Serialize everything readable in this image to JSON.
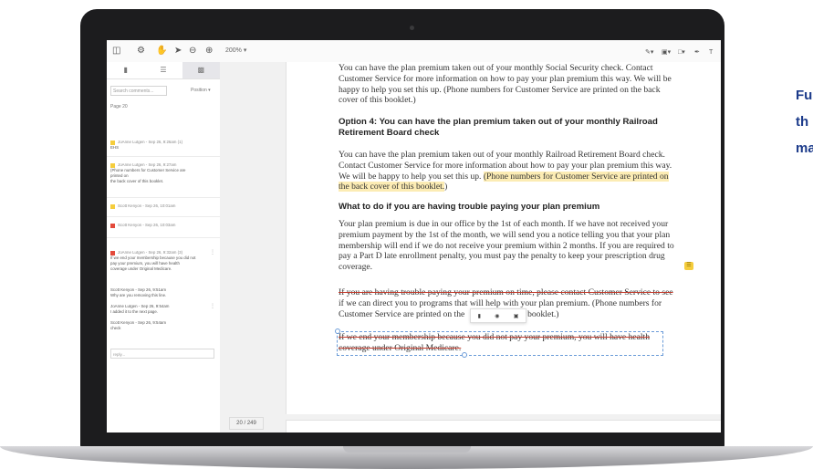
{
  "side_text": [
    "Fu",
    "th",
    "ma"
  ],
  "toolbar": {
    "zoom": "200%",
    "left_icons": [
      "panel-icon",
      "gear-icon",
      "hand-icon",
      "pointer-icon",
      "zoom-out-icon",
      "zoom-in-icon"
    ],
    "right_icons": [
      "pen-tool-icon",
      "shape-tool-icon",
      "comment-tool-icon",
      "signature-icon",
      "text-tool-icon"
    ]
  },
  "sidebar": {
    "search_placeholder": "Search comments...",
    "position_label": "Position",
    "page_label": "Page 20",
    "comments": [
      {
        "header": "JoAnne Lutgen - Sep 26, 9:26am (1)",
        "body": [
          "EHS"
        ],
        "color": "#f5cd3d"
      },
      {
        "header": "JoAnne Lutgen - Sep 26, 9:27am",
        "body": [
          "(Phone numbers for Customer Service are",
          "printed on",
          "the back cover of this booklet."
        ],
        "color": "#f5cd3d"
      },
      {
        "header": "Scott Kenyon - Sep 26, 10:01am",
        "body": [],
        "color": "#f5cd3d"
      },
      {
        "header": "Scott Kenyon - Sep 26, 10:03am",
        "body": [],
        "color": "#e34a3b"
      },
      {
        "header": "JoAnne Lutgen - Sep 26, 9:32am (3)",
        "body": [
          "If we end your membership because you did not",
          "pay your premium, you will have health",
          "coverage under Original Medicare."
        ],
        "color": "#e34a3b"
      }
    ],
    "replies": [
      {
        "header": "Scott Kenyon - Sep 26, 9:51am",
        "body": "Why are you removing this line."
      },
      {
        "header": "JoAnne Lutgen - Sep 26, 9:54am",
        "body": "I added it to the next page."
      },
      {
        "header": "Scott Kenyon - Sep 26, 9:54am",
        "body": "check"
      }
    ],
    "reply_placeholder": "reply..."
  },
  "page_count": "20 / 249",
  "doc": {
    "p1": [
      "You can have the plan premium taken out of your monthly Social Security check. Contact",
      "Customer Service for more information on how to pay your plan premium this way. We will be",
      "happy to help you set this up. (Phone numbers for Customer Service are printed on the back",
      "cover of this booklet.)"
    ],
    "h1": [
      "Option 4: You can have the plan premium taken out of your monthly Railroad",
      "Retirement Board check"
    ],
    "p2": [
      "You can have the plan premium taken out of your monthly Railroad Retirement Board check.",
      "Contact Customer Service for more information about how to pay your plan premium this way.",
      "We will be happy to help you set this up. "
    ],
    "p2_hl_1": "(Phone numbers for Customer Service are printed on",
    "p2_hl_2": "the back cover of this booklet.",
    "p2_end": ")",
    "h2": "What to do if you are having trouble paying your plan premium",
    "p3": [
      "Your plan premium is due in our office by the 1st of each month. If we have not received your",
      "premium payment by the 1st of the month, we will send you a notice telling you that your plan",
      "membership will end if we do not receive your premium within 2 months. If you are required to",
      "pay a Part D late enrollment penalty, you must pay the penalty to keep your prescription drug",
      "coverage."
    ],
    "p4_strike": "If you are having trouble paying your premium on time, please contact Customer Service to see",
    "p4_l2": "if we can direct you to programs that will help with your plan premium. (Phone numbers for",
    "p4_l3a": "Customer Service are printed on the",
    "p4_l3b": "is booklet.)",
    "p5_strike": [
      "If we end your membership because you did not pay your premium, you will have health",
      "coverage under Original Medicare."
    ]
  }
}
